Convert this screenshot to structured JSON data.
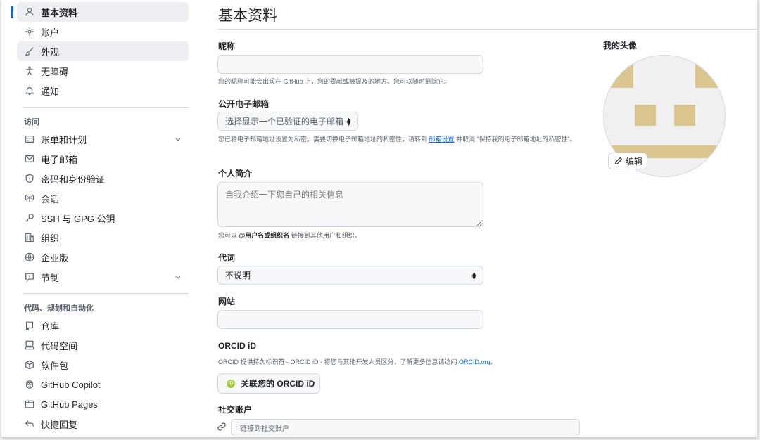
{
  "sidebar": {
    "items": [
      {
        "label": "基本资料"
      },
      {
        "label": "账户"
      },
      {
        "label": "外观"
      },
      {
        "label": "无障碍"
      },
      {
        "label": "通知"
      }
    ],
    "access_title": "访问",
    "access_items": [
      {
        "label": "账单和计划"
      },
      {
        "label": "电子邮箱"
      },
      {
        "label": "密码和身份验证"
      },
      {
        "label": "会话"
      },
      {
        "label": "SSH 与 GPG 公钥"
      },
      {
        "label": "组织"
      },
      {
        "label": "企业版"
      },
      {
        "label": "节制"
      }
    ],
    "code_title": "代码、规划和自动化",
    "code_items": [
      {
        "label": "仓库"
      },
      {
        "label": "代码空间"
      },
      {
        "label": "软件包"
      },
      {
        "label": "GitHub Copilot"
      },
      {
        "label": "GitHub Pages"
      },
      {
        "label": "快捷回复"
      }
    ]
  },
  "main": {
    "title": "基本资料",
    "nickname": {
      "label": "昵称",
      "value": "",
      "note": "您的昵称可能会出现在 GitHub 上，您的贡献或被提及的地方。您可以随时删除它。"
    },
    "public_email": {
      "label": "公开电子邮箱",
      "selected": "选择显示一个已验证的电子邮箱",
      "note_before": "您已将电子邮箱地址设置为私密。需要切换电子邮箱地址的私密性，请转到",
      "note_link": "邮箱设置",
      "note_after": "并取消 “保持我的电子邮箱地址的私密性”。"
    },
    "bio": {
      "label": "个人简介",
      "placeholder": "自我介绍一下您自己的相关信息",
      "note_before": "您可以",
      "note_bold": "@用户名或组织名",
      "note_after": "链接到其他用户和组织。"
    },
    "pronouns": {
      "label": "代词",
      "selected": "不说明"
    },
    "website": {
      "label": "网站",
      "value": ""
    },
    "orcid": {
      "label": "ORCID iD",
      "note_before": "ORCID 提供持久标识符 - ORCID iD - 将您与其他开发人员区分，了解更多信息请访问",
      "note_link": "ORCID.org",
      "note_after": "。",
      "button": "关联您的 ORCID iD",
      "badge": "iD"
    },
    "social": {
      "label": "社交账户",
      "placeholder": "链接到社交账户"
    }
  },
  "avatar": {
    "label": "我的头像",
    "edit": "编辑"
  },
  "colors": {
    "accent": "#0969da",
    "avatar_fill": "#dcc68f",
    "orcid_green": "#a6ce39"
  }
}
